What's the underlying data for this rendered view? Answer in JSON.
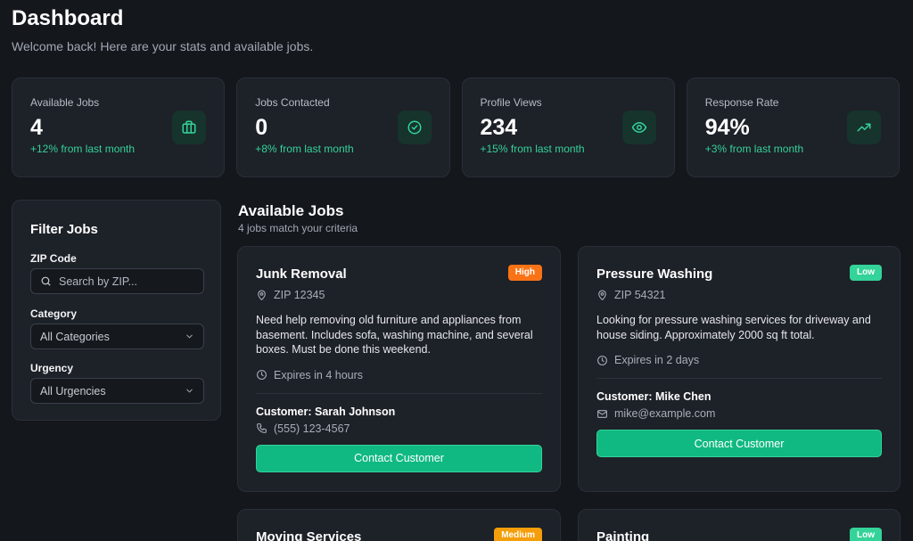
{
  "header": {
    "title": "Dashboard",
    "subtitle": "Welcome back! Here are your stats and available jobs."
  },
  "stats": [
    {
      "label": "Available Jobs",
      "value": "4",
      "change": "+12% from last month",
      "icon": "briefcase-icon"
    },
    {
      "label": "Jobs Contacted",
      "value": "0",
      "change": "+8% from last month",
      "icon": "check-circle-icon"
    },
    {
      "label": "Profile Views",
      "value": "234",
      "change": "+15% from last month",
      "icon": "eye-icon"
    },
    {
      "label": "Response Rate",
      "value": "94%",
      "change": "+3% from last month",
      "icon": "trending-up-icon"
    }
  ],
  "filters": {
    "title": "Filter Jobs",
    "zip_label": "ZIP Code",
    "zip_placeholder": "Search by ZIP...",
    "category_label": "Category",
    "category_value": "All Categories",
    "urgency_label": "Urgency",
    "urgency_value": "All Urgencies"
  },
  "jobs_section": {
    "title": "Available Jobs",
    "subtitle": "4 jobs match your criteria"
  },
  "jobs": [
    {
      "title": "Junk Removal",
      "urgency": "High",
      "zip": "ZIP 12345",
      "description": "Need help removing old furniture and appliances from basement. Includes sofa, washing machine, and several boxes. Must be done this weekend.",
      "expires": "Expires in 4 hours",
      "customer": "Customer: Sarah Johnson",
      "contact": "(555) 123-4567",
      "button": "Contact Customer"
    },
    {
      "title": "Pressure Washing",
      "urgency": "Low",
      "zip": "ZIP 54321",
      "description": "Looking for pressure washing services for driveway and house siding. Approximately 2000 sq ft total.",
      "expires": "Expires in 2 days",
      "customer": "Customer: Mike Chen",
      "contact": "mike@example.com",
      "button": "Contact Customer"
    },
    {
      "title": "Moving Services",
      "urgency": "Medium"
    },
    {
      "title": "Painting",
      "urgency": "Low"
    }
  ],
  "colors": {
    "accent": "#10b981",
    "badge_high": "#f97316",
    "badge_medium": "#f59e0b",
    "badge_low": "#34d399"
  }
}
